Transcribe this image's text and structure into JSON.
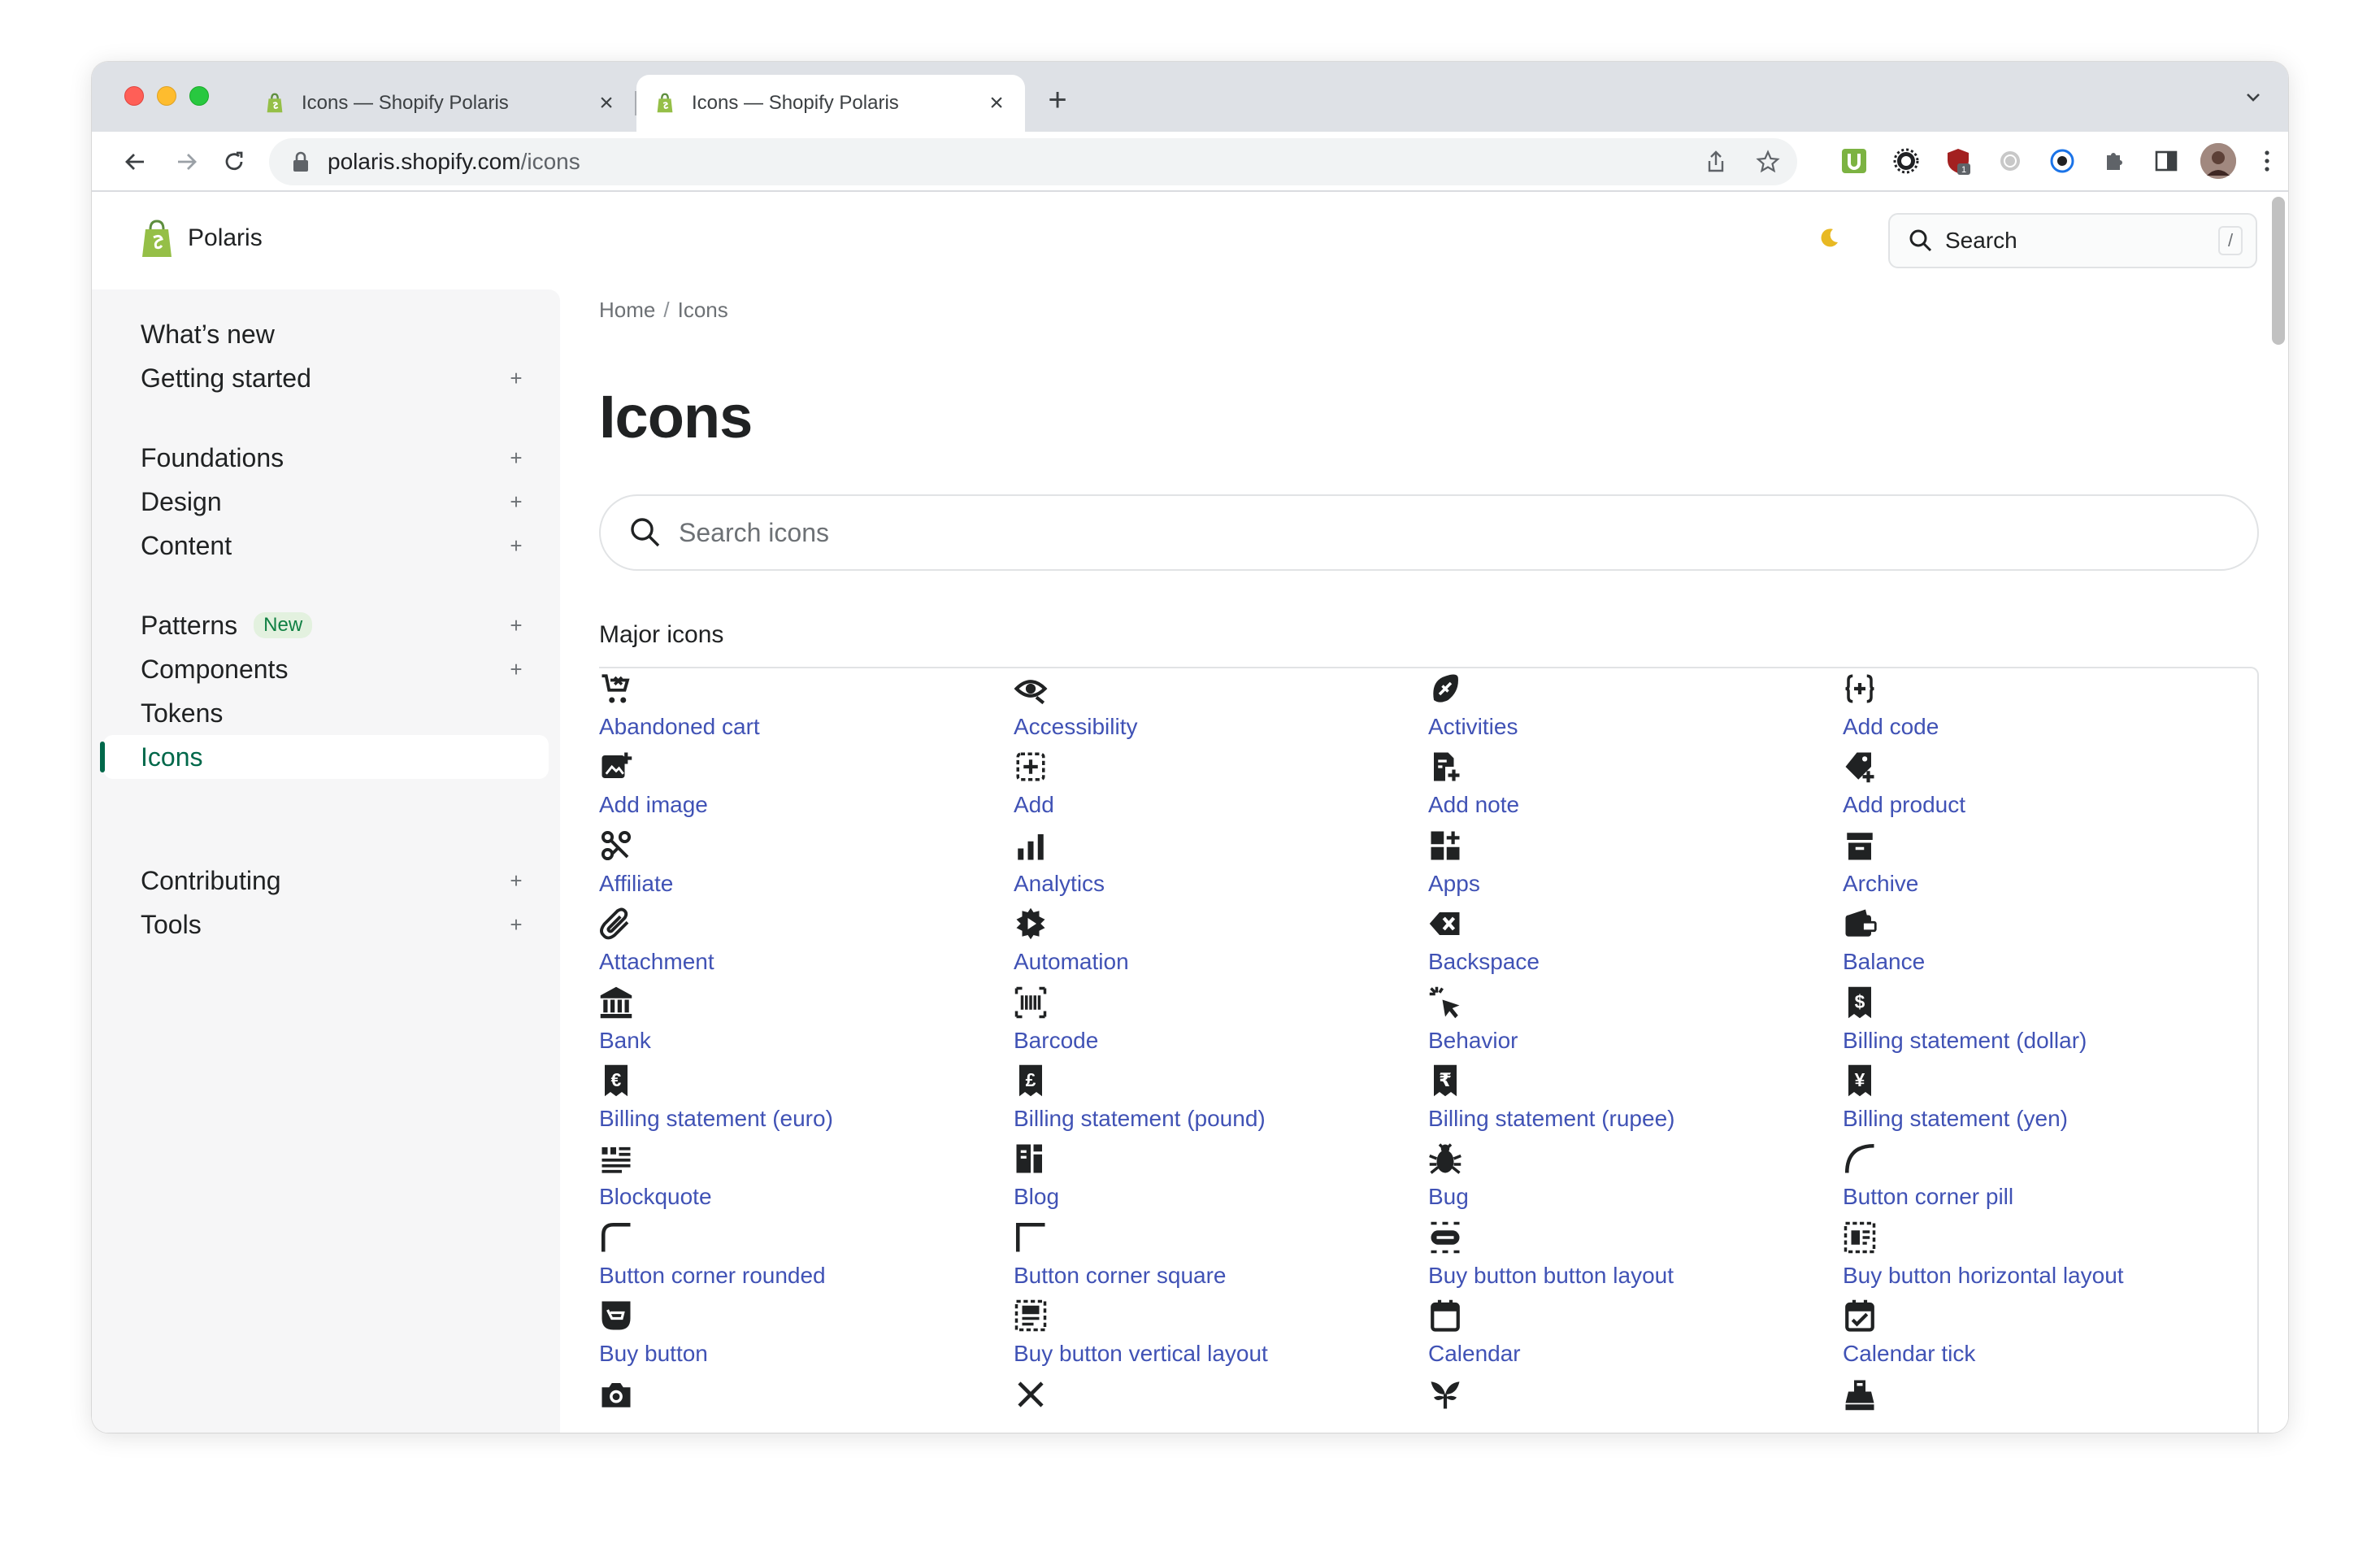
{
  "browser": {
    "tabs": [
      {
        "title": "Icons — Shopify Polaris",
        "active": false
      },
      {
        "title": "Icons — Shopify Polaris",
        "active": true
      }
    ],
    "url_host": "polaris.shopify.com",
    "url_path": "/icons",
    "extension_badge": "1",
    "colors": {
      "tabbar": "#dee1e6",
      "omnibox": "#f1f3f4"
    }
  },
  "site": {
    "brand": "Polaris",
    "top_search_placeholder": "Search",
    "top_search_shortcut": "/",
    "theme_toggle_icon": "moon-icon"
  },
  "sidebar": {
    "groups": [
      [
        {
          "label": "What’s new",
          "expandable": false
        },
        {
          "label": "Getting started",
          "expandable": true
        }
      ],
      [
        {
          "label": "Foundations",
          "expandable": true
        },
        {
          "label": "Design",
          "expandable": true
        },
        {
          "label": "Content",
          "expandable": true
        }
      ],
      [
        {
          "label": "Patterns",
          "badge": "New",
          "expandable": true
        },
        {
          "label": "Components",
          "expandable": true
        },
        {
          "label": "Tokens",
          "expandable": false
        },
        {
          "label": "Icons",
          "expandable": false,
          "active": true
        }
      ],
      [
        {
          "label": "Contributing",
          "expandable": true
        },
        {
          "label": "Tools",
          "expandable": true
        }
      ]
    ],
    "plus": "+",
    "accent": "#00684a"
  },
  "main": {
    "breadcrumb": {
      "home": "Home",
      "sep": "/",
      "current": "Icons"
    },
    "title": "Icons",
    "search_placeholder": "Search icons",
    "section_title": "Major icons",
    "link_color": "#4052b5",
    "icons": [
      {
        "name": "Abandoned cart",
        "icon": "abandoned-cart-icon"
      },
      {
        "name": "Accessibility",
        "icon": "accessibility-icon"
      },
      {
        "name": "Activities",
        "icon": "activities-icon"
      },
      {
        "name": "Add code",
        "icon": "add-code-icon"
      },
      {
        "name": "Add image",
        "icon": "add-image-icon"
      },
      {
        "name": "Add",
        "icon": "add-icon"
      },
      {
        "name": "Add note",
        "icon": "add-note-icon"
      },
      {
        "name": "Add product",
        "icon": "add-product-icon"
      },
      {
        "name": "Affiliate",
        "icon": "affiliate-icon"
      },
      {
        "name": "Analytics",
        "icon": "analytics-icon"
      },
      {
        "name": "Apps",
        "icon": "apps-icon"
      },
      {
        "name": "Archive",
        "icon": "archive-icon"
      },
      {
        "name": "Attachment",
        "icon": "attachment-icon"
      },
      {
        "name": "Automation",
        "icon": "automation-icon"
      },
      {
        "name": "Backspace",
        "icon": "backspace-icon"
      },
      {
        "name": "Balance",
        "icon": "balance-icon"
      },
      {
        "name": "Bank",
        "icon": "bank-icon"
      },
      {
        "name": "Barcode",
        "icon": "barcode-icon"
      },
      {
        "name": "Behavior",
        "icon": "behavior-icon"
      },
      {
        "name": "Billing statement (dollar)",
        "icon": "billing-dollar-icon"
      },
      {
        "name": "Billing statement (euro)",
        "icon": "billing-euro-icon"
      },
      {
        "name": "Billing statement (pound)",
        "icon": "billing-pound-icon"
      },
      {
        "name": "Billing statement (rupee)",
        "icon": "billing-rupee-icon"
      },
      {
        "name": "Billing statement (yen)",
        "icon": "billing-yen-icon"
      },
      {
        "name": "Blockquote",
        "icon": "blockquote-icon"
      },
      {
        "name": "Blog",
        "icon": "blog-icon"
      },
      {
        "name": "Bug",
        "icon": "bug-icon"
      },
      {
        "name": "Button corner pill",
        "icon": "button-corner-pill-icon"
      },
      {
        "name": "Button corner rounded",
        "icon": "button-corner-rounded-icon"
      },
      {
        "name": "Button corner square",
        "icon": "button-corner-square-icon"
      },
      {
        "name": "Buy button button layout",
        "icon": "buy-button-layout-icon"
      },
      {
        "name": "Buy button horizontal layout",
        "icon": "buy-button-horizontal-icon"
      },
      {
        "name": "Buy button",
        "icon": "buy-button-icon"
      },
      {
        "name": "Buy button vertical layout",
        "icon": "buy-button-vertical-icon"
      },
      {
        "name": "Calendar",
        "icon": "calendar-icon"
      },
      {
        "name": "Calendar tick",
        "icon": "calendar-tick-icon"
      },
      {
        "name": "",
        "icon": "camera-icon"
      },
      {
        "name": "",
        "icon": "cancel-icon"
      },
      {
        "name": "",
        "icon": "cannabis-icon"
      },
      {
        "name": "",
        "icon": "cash-register-icon"
      }
    ]
  }
}
